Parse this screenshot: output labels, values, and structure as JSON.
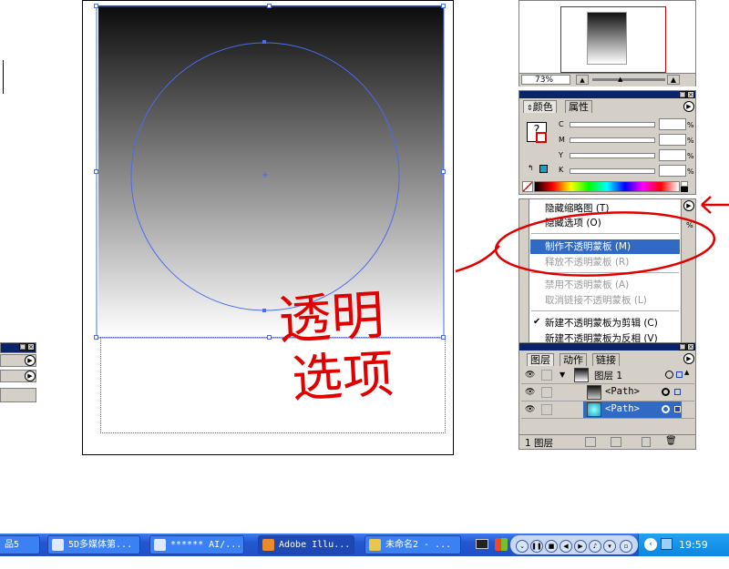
{
  "zoom": "73%",
  "color_panel": {
    "tabs": [
      "颜色",
      "属性"
    ],
    "channels": [
      "C",
      "M",
      "Y",
      "K"
    ],
    "percent_sign": "%"
  },
  "transparency_menu": {
    "items": [
      {
        "label": "隐藏缩略图 (T)",
        "enabled": true
      },
      {
        "label": "隐藏选项 (O)",
        "enabled": true
      },
      {
        "label": "制作不透明蒙板 (M)",
        "enabled": true,
        "highlighted": true
      },
      {
        "label": "释放不透明蒙板 (R)",
        "enabled": false
      },
      {
        "label": "禁用不透明蒙板 (A)",
        "enabled": false
      },
      {
        "label": "取消链接不透明蒙板 (L)",
        "enabled": false
      },
      {
        "label": "新建不透明蒙板为剪辑 (C)",
        "enabled": true,
        "checked": true
      },
      {
        "label": "新建不透明蒙板为反相 (V)",
        "enabled": true
      }
    ]
  },
  "layers_panel": {
    "tabs": [
      "图层",
      "动作",
      "链接"
    ],
    "rows": [
      {
        "name": "图层 1",
        "level": 0,
        "selected": false
      },
      {
        "name": "<Path>",
        "level": 1,
        "selected": false
      },
      {
        "name": "<Path>",
        "level": 1,
        "selected": true
      }
    ],
    "footer": "1 图层"
  },
  "annotation": {
    "line1": "透明",
    "line2": "选项",
    "color": "#e00000"
  },
  "taskbar": {
    "clipped_label": "品5",
    "tasks": [
      "5D多媒体第...",
      "****** AI/...",
      "Adobe Illu...",
      "未命名2 - ..."
    ],
    "active_task_index": 2,
    "clock": "19:59"
  },
  "colors": {
    "selection_blue": "#4a6cf0",
    "title_blue": "#0a246a",
    "menu_highlight": "#316ac5",
    "taskbar_blue": "#2457d0"
  }
}
